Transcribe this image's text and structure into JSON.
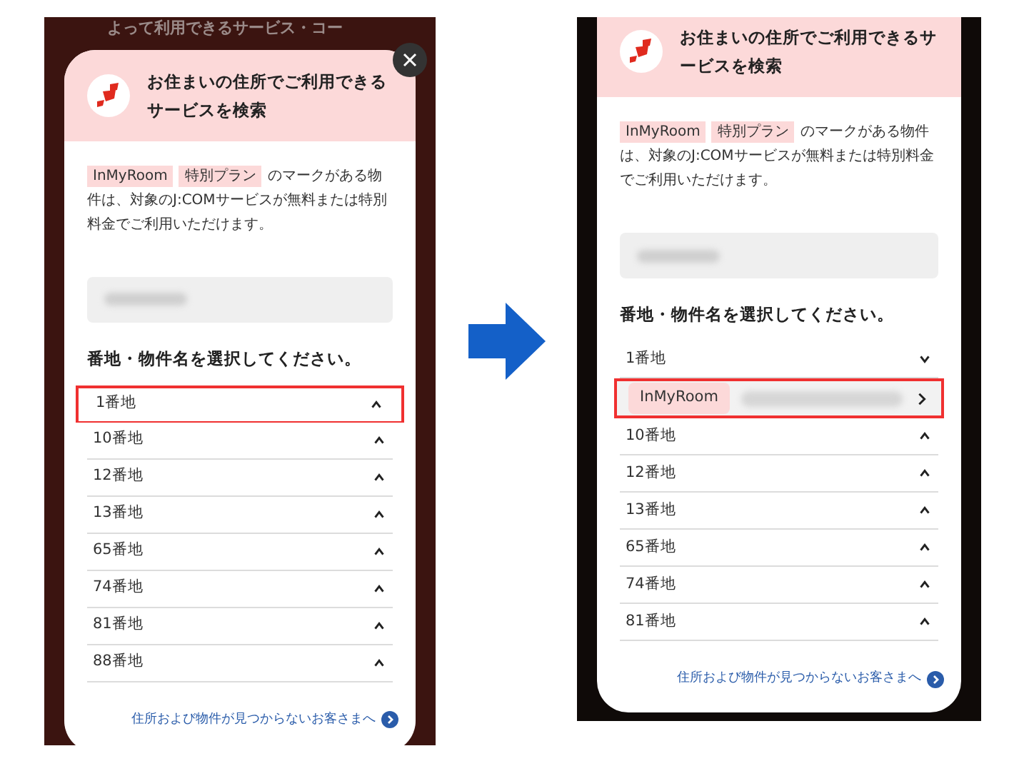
{
  "screens": [
    {
      "background_text": "よって利用できるサービス・コー",
      "close_button": true,
      "header": {
        "title": "お住まいの住所でご利用できるサービスを検索"
      },
      "notice": {
        "tags": [
          "InMyRoom",
          "特別プラン"
        ],
        "text": "のマークがある物件は、対象のJ:COMサービスが無料または特別料金でご利用いただけます。"
      },
      "prompt": "番地・物件名を選択してください。",
      "items": [
        {
          "label": "1番地",
          "expanded": false,
          "highlighted": true
        },
        {
          "label": "10番地",
          "expanded": false,
          "highlighted": false
        },
        {
          "label": "12番地",
          "expanded": false,
          "highlighted": false
        },
        {
          "label": "13番地",
          "expanded": false,
          "highlighted": false
        },
        {
          "label": "65番地",
          "expanded": false,
          "highlighted": false
        },
        {
          "label": "74番地",
          "expanded": false,
          "highlighted": false
        },
        {
          "label": "81番地",
          "expanded": false,
          "highlighted": false
        },
        {
          "label": "88番地",
          "expanded": false,
          "highlighted": false
        }
      ],
      "footer_link": "住所および物件が見つからないお客さまへ"
    },
    {
      "header": {
        "title": "お住まいの住所でご利用できるサービスを検索"
      },
      "notice": {
        "tags": [
          "InMyRoom",
          "特別プラン"
        ],
        "text": "のマークがある物件は、対象のJ:COMサービスが無料または特別料金でご利用いただけます。"
      },
      "prompt": "番地・物件名を選択してください。",
      "items": [
        {
          "label": "1番地",
          "expanded": true,
          "highlighted": false,
          "children": [
            {
              "tag": "InMyRoom",
              "highlighted": true
            }
          ]
        },
        {
          "label": "10番地",
          "expanded": false,
          "highlighted": false
        },
        {
          "label": "12番地",
          "expanded": false,
          "highlighted": false
        },
        {
          "label": "13番地",
          "expanded": false,
          "highlighted": false
        },
        {
          "label": "65番地",
          "expanded": false,
          "highlighted": false
        },
        {
          "label": "74番地",
          "expanded": false,
          "highlighted": false
        },
        {
          "label": "81番地",
          "expanded": false,
          "highlighted": false
        }
      ],
      "footer_link": "住所および物件が見つからないお客さまへ"
    }
  ]
}
